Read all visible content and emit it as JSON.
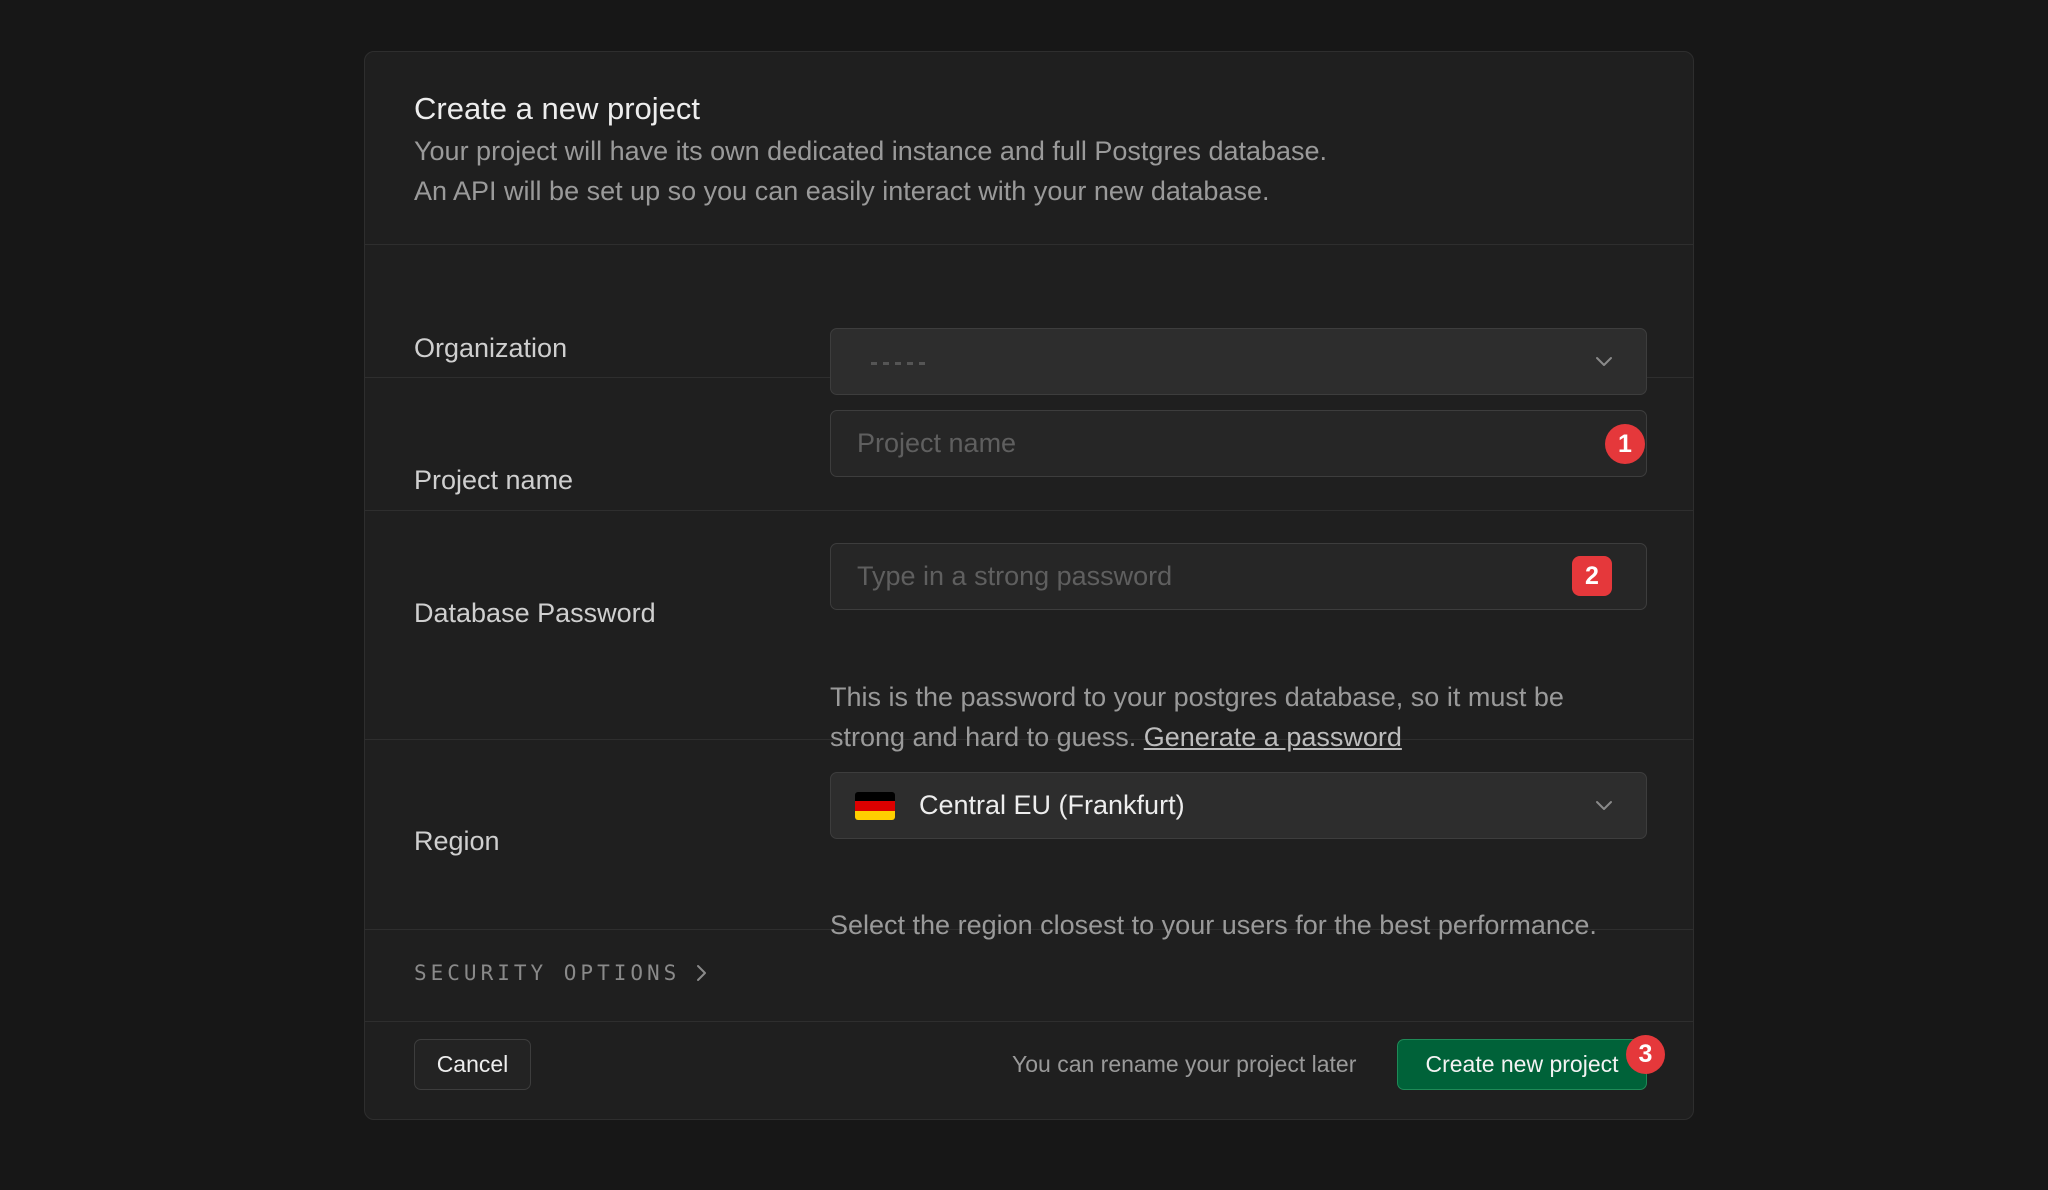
{
  "dialog": {
    "title": "Create a new project",
    "subtitle_line1": "Your project will have its own dedicated instance and full Postgres database.",
    "subtitle_line2": "An API will be set up so you can easily interact with your new database."
  },
  "organization": {
    "label": "Organization",
    "value": ""
  },
  "project_name": {
    "label": "Project name",
    "placeholder": "Project name",
    "badge": "1"
  },
  "database_password": {
    "label": "Database Password",
    "placeholder": "Type in a strong password",
    "badge": "2",
    "help_line1": "This is the password to your postgres database, so it must be",
    "help_line2_prefix": "strong and hard to guess.",
    "generate_link": "Generate a password"
  },
  "region": {
    "label": "Region",
    "value": "Central EU (Frankfurt)",
    "flag_icon": "germany-flag-icon",
    "help": "Select the region closest to your users for the best performance."
  },
  "security_options": {
    "label": "SECURITY OPTIONS"
  },
  "footer": {
    "cancel_label": "Cancel",
    "note": "You can rename your project later",
    "create_label": "Create new project",
    "badge": "3"
  },
  "colors": {
    "background": "#171717",
    "card": "#1f1f1f",
    "primary_button": "#006239",
    "badge": "#e5383b"
  }
}
